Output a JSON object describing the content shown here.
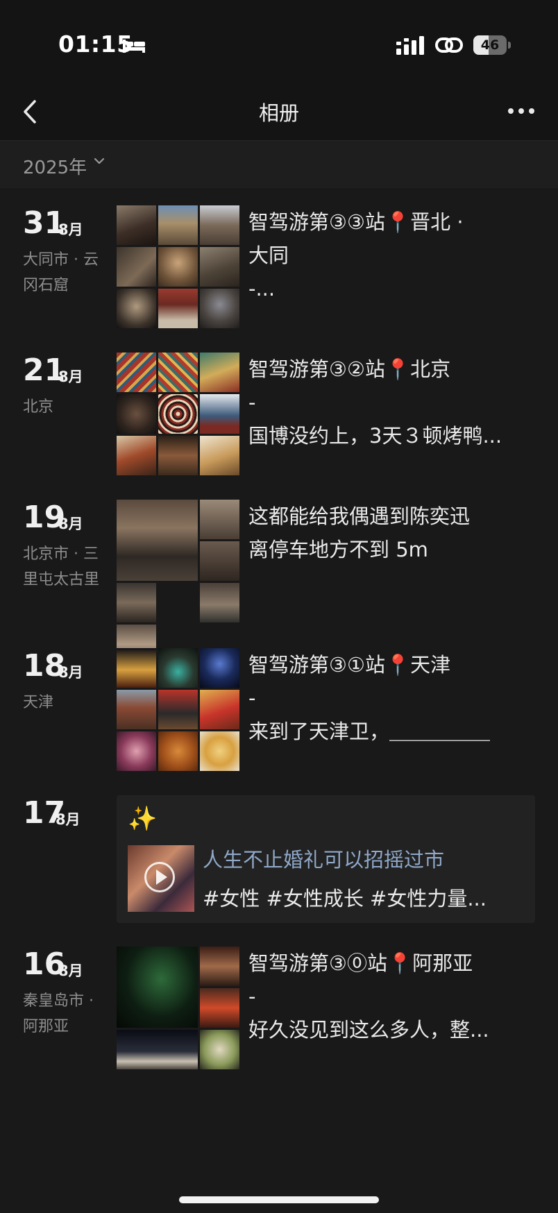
{
  "status_bar": {
    "time": "01:15",
    "battery": "46",
    "battery_level_percent": 46
  },
  "nav": {
    "title": "相册"
  },
  "year_filter": {
    "label": "2025年"
  },
  "entries": [
    {
      "day": "31",
      "month": "8月",
      "location": "大同市 · 云冈石窟",
      "text": "智驾游第③③站📍晋北 ·\n大同\n-..."
    },
    {
      "day": "21",
      "month": "8月",
      "location": "北京",
      "text": "智驾游第③②站📍北京\n-\n国博没约上，3天３顿烤鸭..."
    },
    {
      "day": "19",
      "month": "8月",
      "location": "北京市 · 三里屯太古里",
      "text": "这都能给我偶遇到陈奕迅\n离停车地方不到 5m"
    },
    {
      "day": "18",
      "month": "8月",
      "location": "天津",
      "text": "智驾游第③①站📍天津\n-\n来到了天津卫，＿＿＿＿＿"
    },
    {
      "day": "17",
      "month": "8月",
      "location": "",
      "share": {
        "sparkle": "✨",
        "title": "人生不止婚礼可以招摇过市",
        "tags": "#女性  #女性成长  #女性力量..."
      }
    },
    {
      "day": "16",
      "month": "8月",
      "location": "秦皇岛市 · 阿那亚",
      "text": "智驾游第③⓪站📍阿那亚\n-\n好久没见到这么多人，整..."
    }
  ],
  "colors": {
    "background": "#191919",
    "header": "#141414",
    "location_text": "#8e8e8e",
    "link_blue": "#8fa8c8"
  },
  "icons": {
    "back": "chevron-left-icon",
    "more": "ellipsis-icon",
    "year": "chevron-down-icon",
    "play": "play-icon"
  }
}
